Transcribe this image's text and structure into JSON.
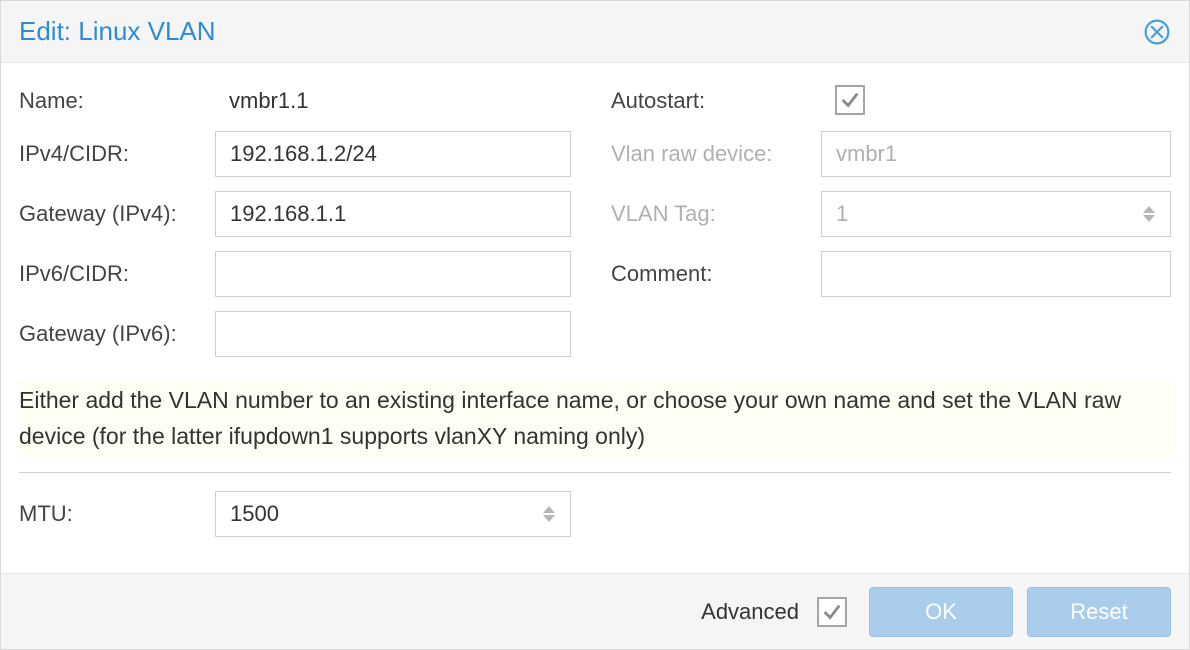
{
  "title": "Edit: Linux VLAN",
  "labels": {
    "name": "Name:",
    "ipv4cidr": "IPv4/CIDR:",
    "gateway4": "Gateway (IPv4):",
    "ipv6cidr": "IPv6/CIDR:",
    "gateway6": "Gateway (IPv6):",
    "autostart": "Autostart:",
    "vlan_raw_device": "Vlan raw device:",
    "vlan_tag": "VLAN Tag:",
    "comment": "Comment:",
    "mtu": "MTU:",
    "advanced": "Advanced"
  },
  "values": {
    "name": "vmbr1.1",
    "ipv4cidr": "192.168.1.2/24",
    "gateway4": "192.168.1.1",
    "ipv6cidr": "",
    "gateway6": "",
    "autostart_checked": true,
    "vlan_raw_device": "vmbr1",
    "vlan_tag": "1",
    "comment": "",
    "mtu": "1500",
    "advanced_checked": true
  },
  "hint": "Either add the VLAN number to an existing interface name, or choose your own name and set the VLAN raw device (for the latter ifupdown1 supports vlanXY naming only)",
  "buttons": {
    "ok": "OK",
    "reset": "Reset"
  }
}
